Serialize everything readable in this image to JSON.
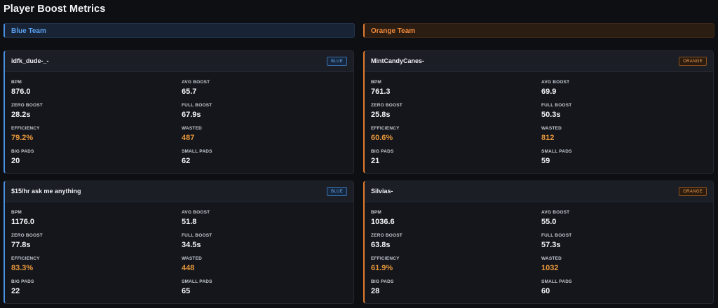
{
  "page": {
    "title": "Player Boost Metrics"
  },
  "teams": {
    "blue": {
      "label": "Blue Team"
    },
    "orange": {
      "label": "Orange Team"
    }
  },
  "colors": {
    "blue_accent": "#4a90e2",
    "orange_accent": "#e07b2e",
    "highlight_value": "#e8973a"
  },
  "cards": [
    {
      "player": "idfk_dude-_-",
      "badge": "BLUE",
      "stats": {
        "bpm": {
          "label": "BPM",
          "value": "876.0"
        },
        "avg_boost": {
          "label": "AVG BOOST",
          "value": "65.7"
        },
        "zero_boost": {
          "label": "ZERO BOOST",
          "value": "28.2s"
        },
        "full_boost": {
          "label": "FULL BOOST",
          "value": "67.9s"
        },
        "efficiency": {
          "label": "EFFICIENCY",
          "value": "79.2%"
        },
        "wasted": {
          "label": "WASTED",
          "value": "487"
        },
        "big_pads": {
          "label": "BIG PADS",
          "value": "20"
        },
        "small_pads": {
          "label": "SMALL PADS",
          "value": "62"
        }
      }
    },
    {
      "player": "MintCandyCanes-",
      "badge": "ORANGE",
      "stats": {
        "bpm": {
          "label": "BPM",
          "value": "761.3"
        },
        "avg_boost": {
          "label": "AVG BOOST",
          "value": "69.9"
        },
        "zero_boost": {
          "label": "ZERO BOOST",
          "value": "25.8s"
        },
        "full_boost": {
          "label": "FULL BOOST",
          "value": "50.3s"
        },
        "efficiency": {
          "label": "EFFICIENCY",
          "value": "60.6%"
        },
        "wasted": {
          "label": "WASTED",
          "value": "812"
        },
        "big_pads": {
          "label": "BIG PADS",
          "value": "21"
        },
        "small_pads": {
          "label": "SMALL PADS",
          "value": "59"
        }
      }
    },
    {
      "player": "$15/hr ask me anything",
      "badge": "BLUE",
      "stats": {
        "bpm": {
          "label": "BPM",
          "value": "1176.0"
        },
        "avg_boost": {
          "label": "AVG BOOST",
          "value": "51.8"
        },
        "zero_boost": {
          "label": "ZERO BOOST",
          "value": "77.8s"
        },
        "full_boost": {
          "label": "FULL BOOST",
          "value": "34.5s"
        },
        "efficiency": {
          "label": "EFFICIENCY",
          "value": "83.3%"
        },
        "wasted": {
          "label": "WASTED",
          "value": "448"
        },
        "big_pads": {
          "label": "BIG PADS",
          "value": "22"
        },
        "small_pads": {
          "label": "SMALL PADS",
          "value": "65"
        }
      }
    },
    {
      "player": "Silvias-",
      "badge": "ORANGE",
      "stats": {
        "bpm": {
          "label": "BPM",
          "value": "1036.6"
        },
        "avg_boost": {
          "label": "AVG BOOST",
          "value": "55.0"
        },
        "zero_boost": {
          "label": "ZERO BOOST",
          "value": "63.8s"
        },
        "full_boost": {
          "label": "FULL BOOST",
          "value": "57.3s"
        },
        "efficiency": {
          "label": "EFFICIENCY",
          "value": "61.9%"
        },
        "wasted": {
          "label": "WASTED",
          "value": "1032"
        },
        "big_pads": {
          "label": "BIG PADS",
          "value": "28"
        },
        "small_pads": {
          "label": "SMALL PADS",
          "value": "60"
        }
      }
    }
  ]
}
